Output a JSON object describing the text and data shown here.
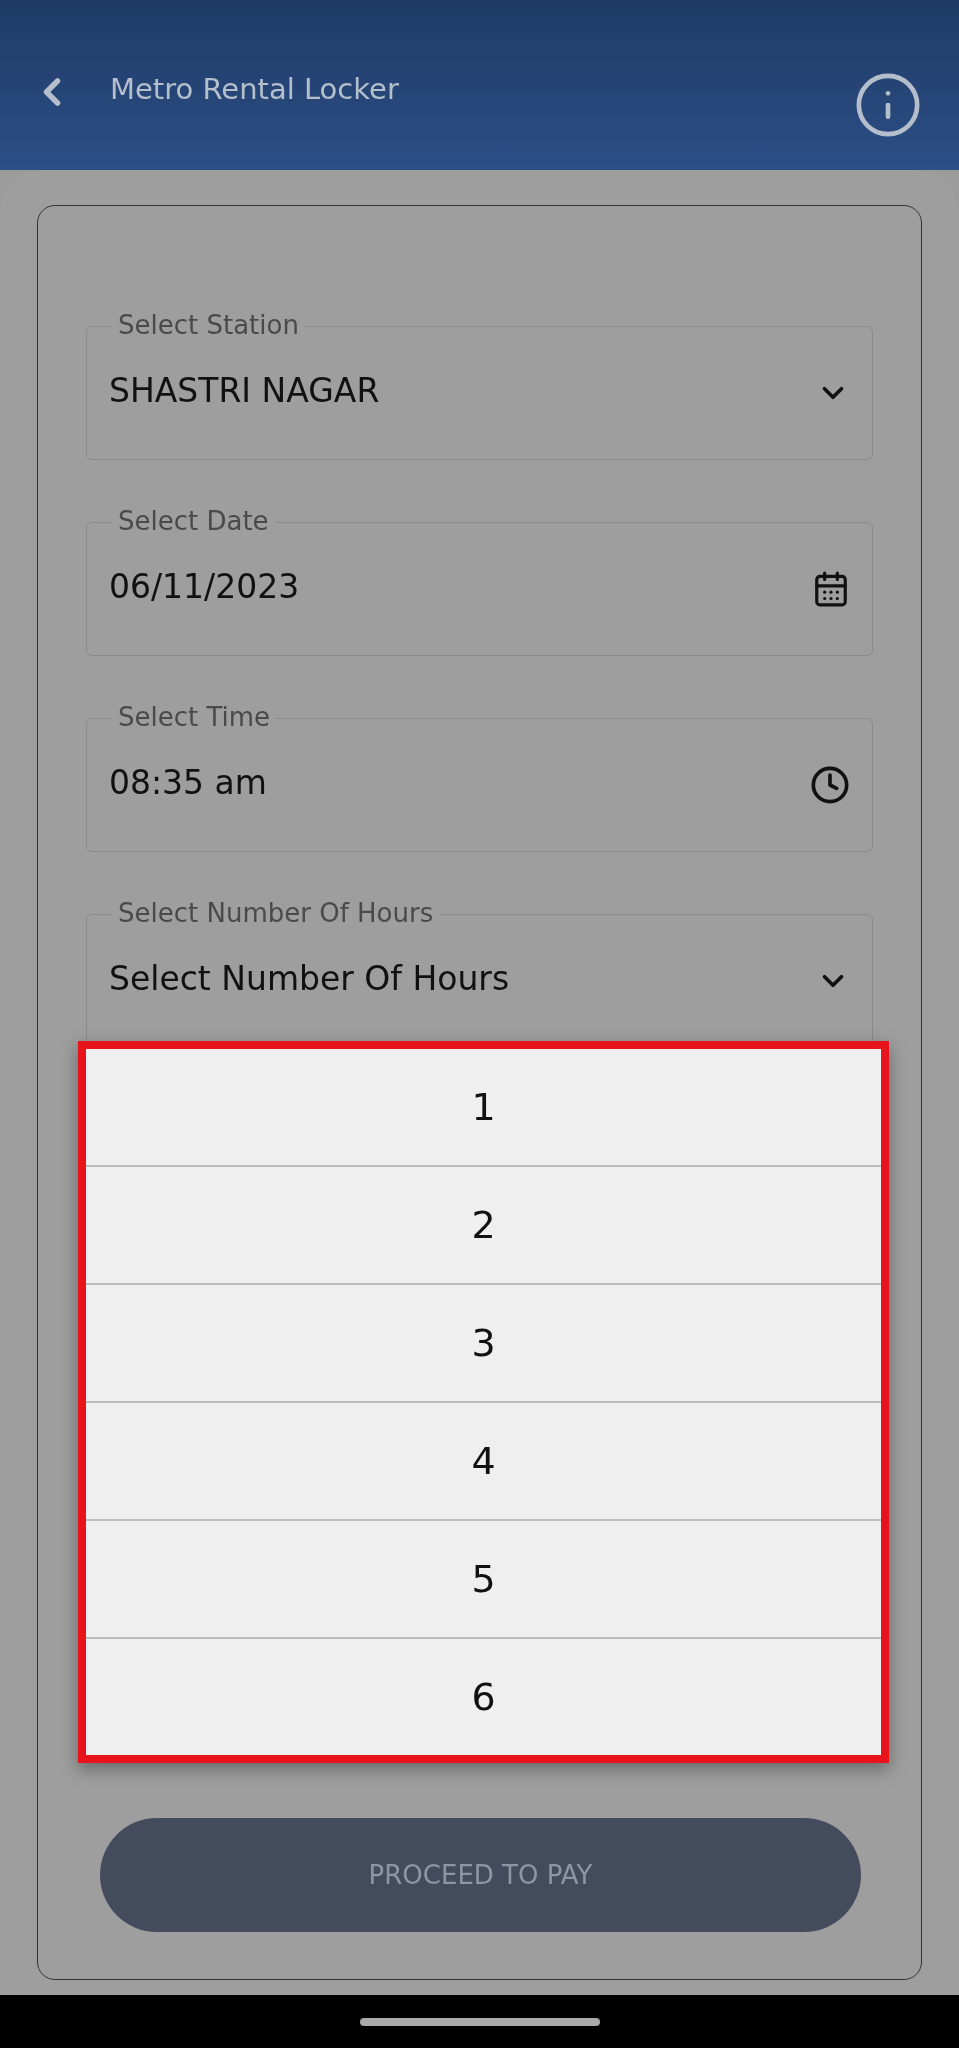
{
  "header": {
    "title": "Metro Rental Locker"
  },
  "fields": [
    {
      "kind": "select",
      "label": "Select Station",
      "value": "SHASTRI NAGAR"
    },
    {
      "kind": "date",
      "label": "Select Date",
      "value": "06/11/2023"
    },
    {
      "kind": "time",
      "label": "Select Time",
      "value": "08:35 am"
    },
    {
      "kind": "select",
      "label": "Select Number Of Hours",
      "value": "Select Number Of Hours"
    }
  ],
  "dropdown": {
    "options": [
      "1",
      "2",
      "3",
      "4",
      "5",
      "6"
    ]
  },
  "button": {
    "label": "PROCEED TO PAY",
    "disabled": true
  }
}
